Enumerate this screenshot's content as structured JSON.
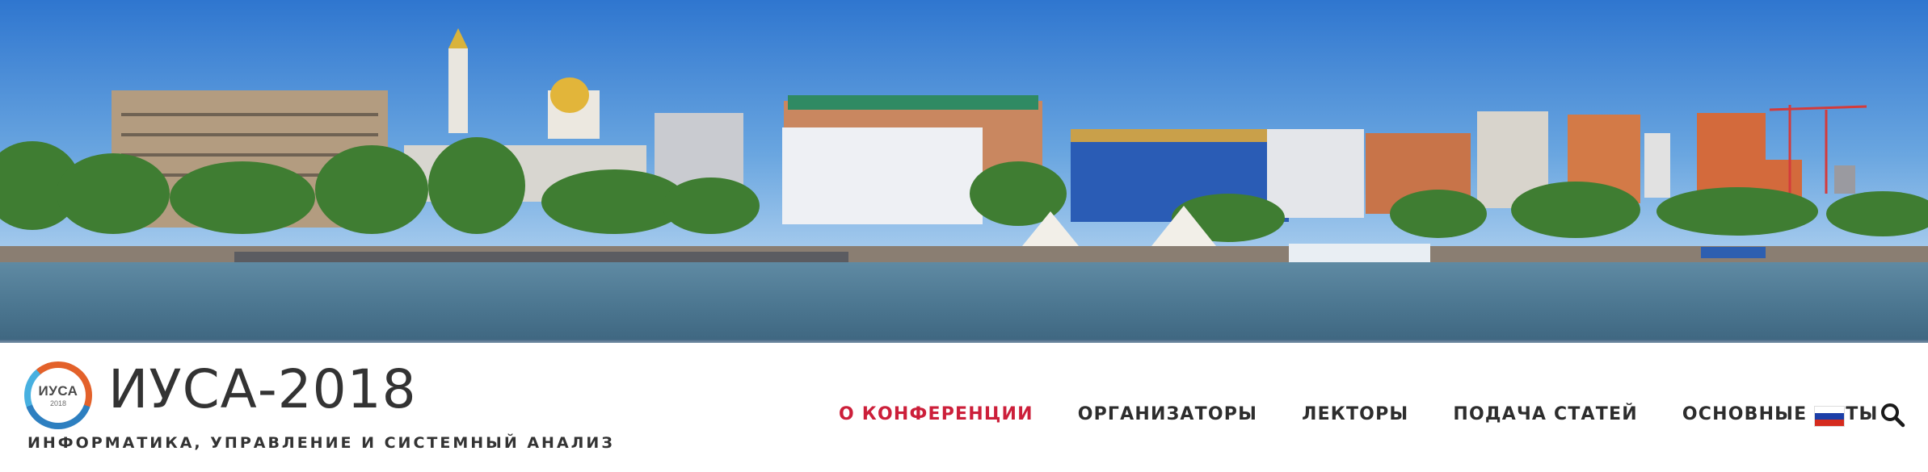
{
  "site": {
    "title": "ИУСА-2018",
    "tagline": "ИНФОРМАТИКА, УПРАВЛЕНИЕ И СИСТЕМНЫЙ АНАЛИЗ",
    "logo": {
      "text": "ИУСА",
      "year": "2018"
    }
  },
  "nav": {
    "items": [
      {
        "label": "О КОНФЕРЕНЦИИ",
        "active": true
      },
      {
        "label": "ОРГАНИЗАТОРЫ",
        "active": false
      },
      {
        "label": "ЛЕКТОРЫ",
        "active": false
      },
      {
        "label": "ПОДАЧА СТАТЕЙ",
        "active": false
      },
      {
        "label": "ОСНОВНЫЕ ДАТЫ",
        "active": false
      }
    ]
  },
  "language": {
    "icon": "russian-flag-icon",
    "colors": [
      "#ffffff",
      "#1c3fa8",
      "#d52b1e"
    ]
  },
  "search": {
    "icon": "search-icon"
  },
  "hero": {
    "image": "city-riverfront-panorama"
  },
  "colors": {
    "accent": "#cc1f3a",
    "text": "#333333",
    "sky": "#4a8ed4",
    "river": "#4d7590"
  }
}
